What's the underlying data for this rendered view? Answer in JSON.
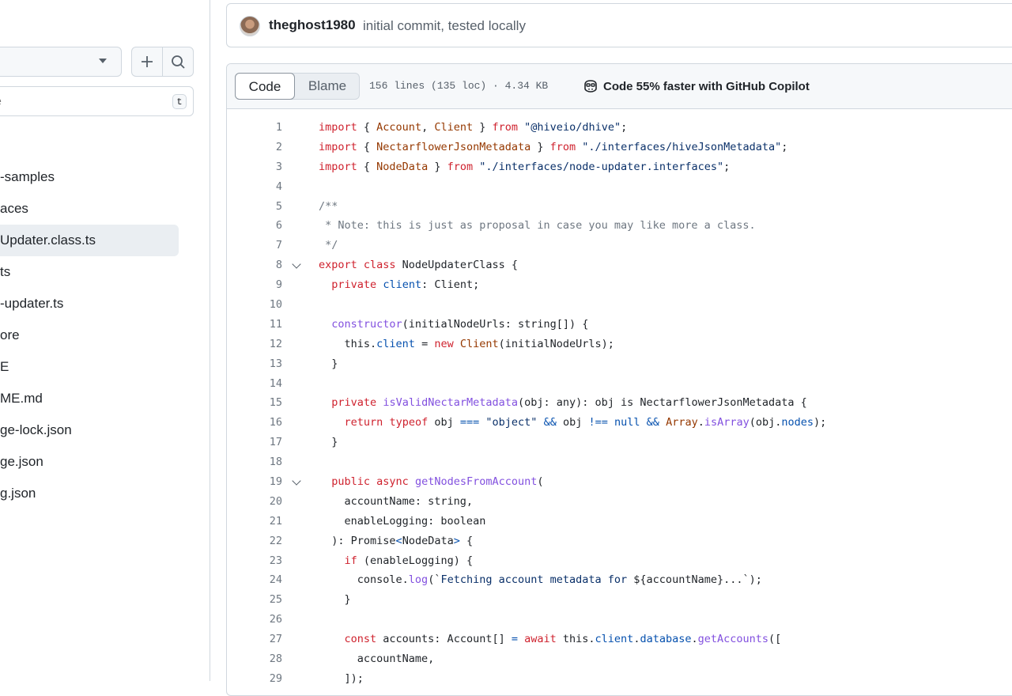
{
  "sidebar": {
    "goto_placeholder": "e",
    "goto_shortcut": "t",
    "items": [
      {
        "label": "-samples"
      },
      {
        "label": "aces"
      },
      {
        "label": "Updater.class.ts"
      },
      {
        "label": "ts"
      },
      {
        "label": "-updater.ts"
      },
      {
        "label": "ore"
      },
      {
        "label": "E"
      },
      {
        "label": "ME.md"
      },
      {
        "label": "ge-lock.json"
      },
      {
        "label": "ge.json"
      },
      {
        "label": "g.json"
      }
    ]
  },
  "commit": {
    "author": "theghost1980",
    "message": "initial commit, tested locally"
  },
  "file": {
    "tab_code": "Code",
    "tab_blame": "Blame",
    "meta": "156 lines (135 loc) · 4.34 KB",
    "copilot": "Code 55% faster with GitHub Copilot"
  },
  "code_lines": [
    {
      "n": "1",
      "fold": false,
      "tokens": [
        [
          "k",
          "import"
        ],
        [
          "",
          "{ "
        ],
        [
          "t",
          "Account"
        ],
        [
          "",
          ", "
        ],
        [
          "t",
          "Client"
        ],
        [
          "",
          " } "
        ],
        [
          "k",
          "from"
        ],
        [
          "",
          " "
        ],
        [
          "s",
          "\"@hiveio/dhive\""
        ],
        [
          "",
          ";"
        ]
      ]
    },
    {
      "n": "2",
      "fold": false,
      "tokens": [
        [
          "k",
          "import"
        ],
        [
          "",
          "{ "
        ],
        [
          "t",
          "NectarflowerJsonMetadata"
        ],
        [
          "",
          " } "
        ],
        [
          "k",
          "from"
        ],
        [
          "",
          " "
        ],
        [
          "s",
          "\"./interfaces/hiveJsonMetadata\""
        ],
        [
          "",
          ";"
        ]
      ]
    },
    {
      "n": "3",
      "fold": false,
      "tokens": [
        [
          "k",
          "import"
        ],
        [
          "",
          "{ "
        ],
        [
          "t",
          "NodeData"
        ],
        [
          "",
          " } "
        ],
        [
          "k",
          "from"
        ],
        [
          "",
          " "
        ],
        [
          "s",
          "\"./interfaces/node-updater.interfaces\""
        ],
        [
          "",
          ";"
        ]
      ]
    },
    {
      "n": "4",
      "fold": false,
      "tokens": []
    },
    {
      "n": "5",
      "fold": false,
      "tokens": [
        [
          "c",
          "/**"
        ]
      ]
    },
    {
      "n": "6",
      "fold": false,
      "tokens": [
        [
          "c",
          " * Note: this is just as proposal in case you may like more a class."
        ]
      ]
    },
    {
      "n": "7",
      "fold": false,
      "tokens": [
        [
          "c",
          " */"
        ]
      ]
    },
    {
      "n": "8",
      "fold": true,
      "tokens": [
        [
          "k",
          "export class"
        ],
        [
          "",
          " NodeUpdaterClass {"
        ]
      ]
    },
    {
      "n": "9",
      "fold": false,
      "tokens": [
        [
          "",
          "  "
        ],
        [
          "k",
          "private"
        ],
        [
          "",
          " "
        ],
        [
          "p",
          "client"
        ],
        [
          "",
          ": Client;"
        ]
      ]
    },
    {
      "n": "10",
      "fold": false,
      "tokens": []
    },
    {
      "n": "11",
      "fold": false,
      "tokens": [
        [
          "",
          "  "
        ],
        [
          "f",
          "constructor"
        ],
        [
          "",
          "(initialNodeUrls: string[]) {"
        ]
      ]
    },
    {
      "n": "12",
      "fold": false,
      "tokens": [
        [
          "",
          "    this."
        ],
        [
          "p",
          "client"
        ],
        [
          "",
          " = "
        ],
        [
          "k",
          "new"
        ],
        [
          "",
          " "
        ],
        [
          "t",
          "Client"
        ],
        [
          "",
          "(initialNodeUrls);"
        ]
      ]
    },
    {
      "n": "13",
      "fold": false,
      "tokens": [
        [
          "",
          "  }"
        ]
      ]
    },
    {
      "n": "14",
      "fold": false,
      "tokens": []
    },
    {
      "n": "15",
      "fold": false,
      "tokens": [
        [
          "",
          "  "
        ],
        [
          "k",
          "private"
        ],
        [
          "",
          " "
        ],
        [
          "f",
          "isValidNectarMetadata"
        ],
        [
          "",
          "(obj: any): obj is NectarflowerJsonMetadata {"
        ]
      ]
    },
    {
      "n": "16",
      "fold": false,
      "tokens": [
        [
          "",
          "    "
        ],
        [
          "k",
          "return"
        ],
        [
          "",
          " "
        ],
        [
          "k",
          "typeof"
        ],
        [
          "",
          " obj "
        ],
        [
          "p",
          "==="
        ],
        [
          "",
          " "
        ],
        [
          "s",
          "\"object\""
        ],
        [
          "",
          " "
        ],
        [
          "p",
          "&&"
        ],
        [
          "",
          " obj "
        ],
        [
          "p",
          "!=="
        ],
        [
          "",
          " "
        ],
        [
          "p",
          "null"
        ],
        [
          "",
          " "
        ],
        [
          "p",
          "&&"
        ],
        [
          "",
          " "
        ],
        [
          "t",
          "Array"
        ],
        [
          "",
          "."
        ],
        [
          "f",
          "isArray"
        ],
        [
          "",
          "(obj."
        ],
        [
          "p",
          "nodes"
        ],
        [
          "",
          ");"
        ]
      ]
    },
    {
      "n": "17",
      "fold": false,
      "tokens": [
        [
          "",
          "  }"
        ]
      ]
    },
    {
      "n": "18",
      "fold": false,
      "tokens": []
    },
    {
      "n": "19",
      "fold": true,
      "tokens": [
        [
          "",
          "  "
        ],
        [
          "k",
          "public async"
        ],
        [
          "",
          " "
        ],
        [
          "f",
          "getNodesFromAccount"
        ],
        [
          "",
          "("
        ]
      ]
    },
    {
      "n": "20",
      "fold": false,
      "tokens": [
        [
          "",
          "    accountName: string,"
        ]
      ]
    },
    {
      "n": "21",
      "fold": false,
      "tokens": [
        [
          "",
          "    enableLogging: boolean"
        ]
      ]
    },
    {
      "n": "22",
      "fold": false,
      "tokens": [
        [
          "",
          "  ): Promise"
        ],
        [
          "p",
          "<"
        ],
        [
          "",
          "NodeData"
        ],
        [
          "p",
          ">"
        ],
        [
          "",
          " {"
        ]
      ]
    },
    {
      "n": "23",
      "fold": false,
      "tokens": [
        [
          "",
          "    "
        ],
        [
          "k",
          "if"
        ],
        [
          "",
          " (enableLogging) {"
        ]
      ]
    },
    {
      "n": "24",
      "fold": false,
      "tokens": [
        [
          "",
          "      console."
        ],
        [
          "f",
          "log"
        ],
        [
          "",
          "(`"
        ],
        [
          "s",
          "Fetching account metadata for "
        ],
        [
          "",
          "${accountName}...`);"
        ]
      ]
    },
    {
      "n": "25",
      "fold": false,
      "tokens": [
        [
          "",
          "    }"
        ]
      ]
    },
    {
      "n": "26",
      "fold": false,
      "tokens": []
    },
    {
      "n": "27",
      "fold": false,
      "tokens": [
        [
          "",
          "    "
        ],
        [
          "k",
          "const"
        ],
        [
          "",
          " accounts: Account[] "
        ],
        [
          "p",
          "="
        ],
        [
          "",
          " "
        ],
        [
          "k",
          "await"
        ],
        [
          "",
          " this."
        ],
        [
          "p",
          "client"
        ],
        [
          "",
          "."
        ],
        [
          "p",
          "database"
        ],
        [
          "",
          "."
        ],
        [
          "f",
          "getAccounts"
        ],
        [
          "",
          "(["
        ]
      ]
    },
    {
      "n": "28",
      "fold": false,
      "tokens": [
        [
          "",
          "      accountName,"
        ]
      ]
    },
    {
      "n": "29",
      "fold": false,
      "tokens": [
        [
          "",
          "    ]);"
        ]
      ]
    }
  ]
}
